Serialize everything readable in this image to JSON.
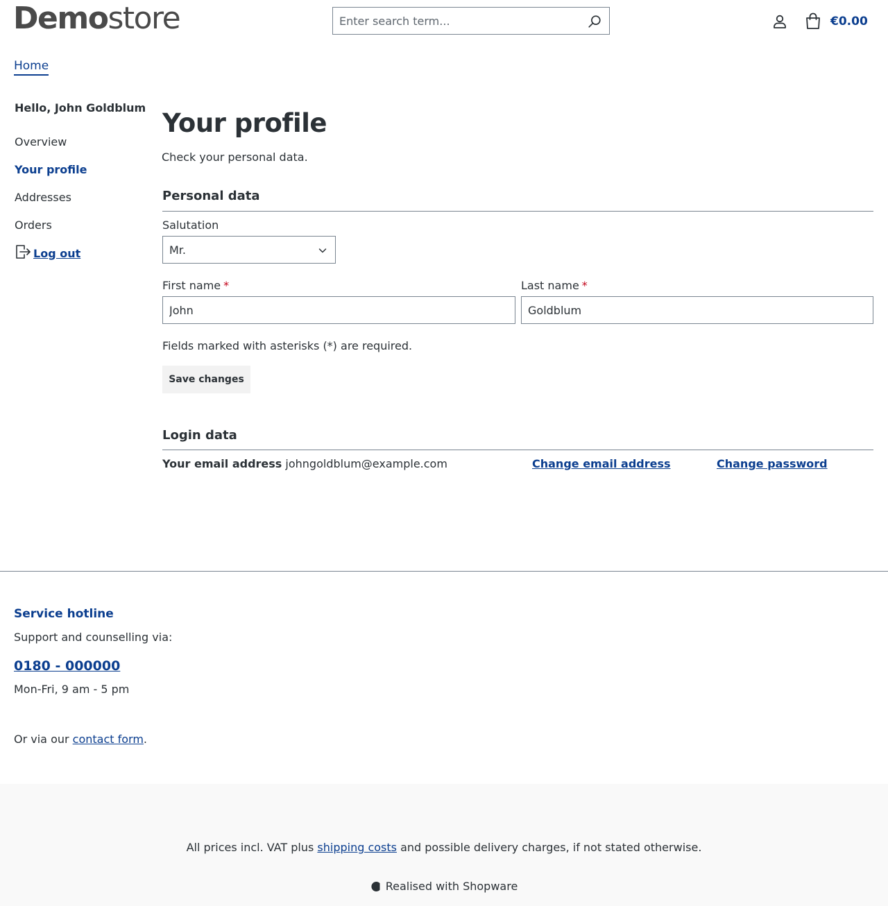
{
  "header": {
    "logo_bold": "Demo",
    "logo_light": "store",
    "search_placeholder": "Enter search term...",
    "cart_amount": "€0.00"
  },
  "breadcrumb": {
    "home": "Home"
  },
  "sidebar": {
    "greeting": "Hello, John Goldblum",
    "items": [
      {
        "label": "Overview",
        "active": false
      },
      {
        "label": "Your profile",
        "active": true
      },
      {
        "label": "Addresses",
        "active": false
      },
      {
        "label": "Orders",
        "active": false
      }
    ],
    "logout": "Log out"
  },
  "main": {
    "title": "Your profile",
    "subtitle": "Check your personal data.",
    "personal_section": "Personal data",
    "salutation_label": "Salutation",
    "salutation_value": "Mr.",
    "first_name_label": "First name",
    "first_name_value": "John",
    "last_name_label": "Last name",
    "last_name_value": "Goldblum",
    "required_marker": "*",
    "required_note": "Fields marked with asterisks (*) are required.",
    "save_button": "Save changes",
    "login_section": "Login data",
    "email_label": "Your email address",
    "email_value": "johngoldblum@example.com",
    "change_email": "Change email address",
    "change_password": "Change password"
  },
  "footer": {
    "hotline_title": "Service hotline",
    "hotline_sub": "Support and counselling via:",
    "hotline_phone": "0180 - 000000",
    "hotline_hours": "Mon-Fri, 9 am - 5 pm",
    "contact_prefix": "Or via our ",
    "contact_link": "contact form",
    "contact_suffix": ".",
    "vat_prefix": "All prices incl. VAT plus ",
    "vat_link": "shipping costs",
    "vat_suffix": " and possible delivery charges, if not stated otherwise.",
    "realised": "Realised with Shopware"
  },
  "colors": {
    "accent": "#0b3e8f",
    "text": "#2b3136",
    "required": "#c20017",
    "border": "#798490",
    "footer_bg": "#f9f9f9"
  }
}
